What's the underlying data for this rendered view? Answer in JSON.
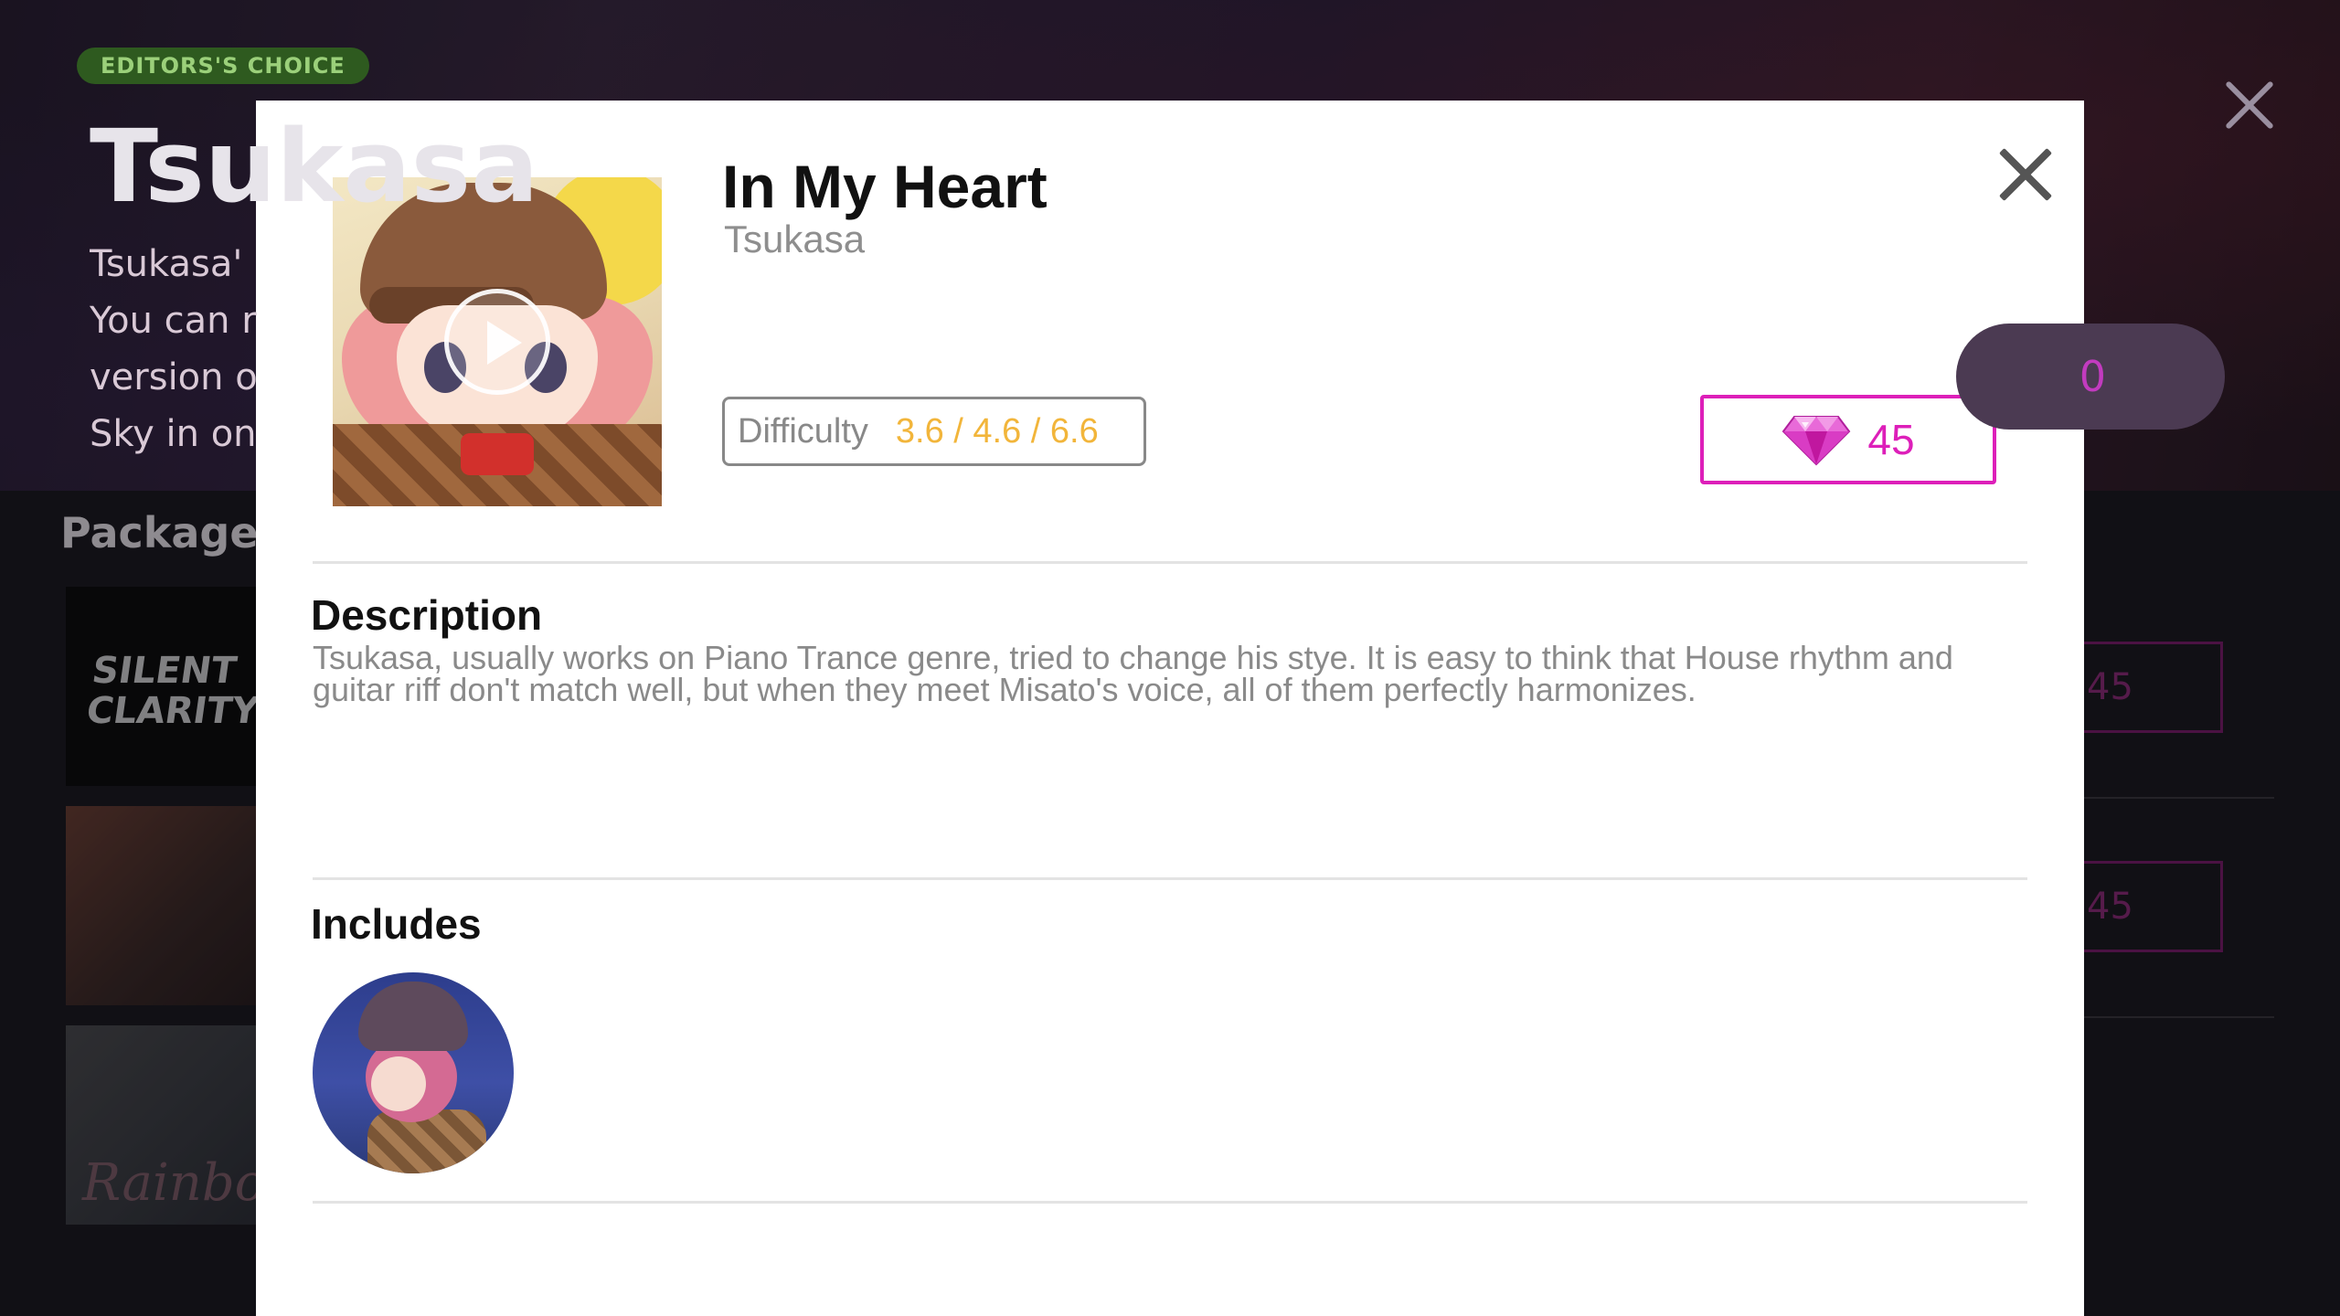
{
  "background": {
    "badge": "EDITORS'S CHOICE",
    "title": "Tsukasa",
    "description_lines": "Tsukasa'\nYou can r\nversion o\nSky in on",
    "buy_price": "0",
    "package_list_title": "Package li",
    "rows": [
      {
        "cover_text": "SILENT\nCLARITY",
        "price": "45"
      },
      {
        "cover_text": "",
        "price": "45"
      },
      {
        "cover_text": "Rainbow",
        "price": ""
      }
    ]
  },
  "modal": {
    "song_title": "In My Heart",
    "artist": "Tsukasa",
    "difficulty_label": "Difficulty",
    "difficulty_values": "3.6 / 4.6 / 6.6",
    "price": "45",
    "description_heading": "Description",
    "description_text": "Tsukasa, usually works on Piano Trance genre, tried to change his stye. It is easy to think that House rhythm and guitar riff don't match well, but when they meet Misato's voice, all of them perfectly harmonizes.",
    "includes_heading": "Includes"
  },
  "icons": {
    "close": "close-icon",
    "play": "play-icon",
    "gem": "gem-icon"
  },
  "colors": {
    "accent_magenta": "#dd1fb9",
    "difficulty_orange": "#f2b53a",
    "text_gray": "#8a8a8a"
  }
}
